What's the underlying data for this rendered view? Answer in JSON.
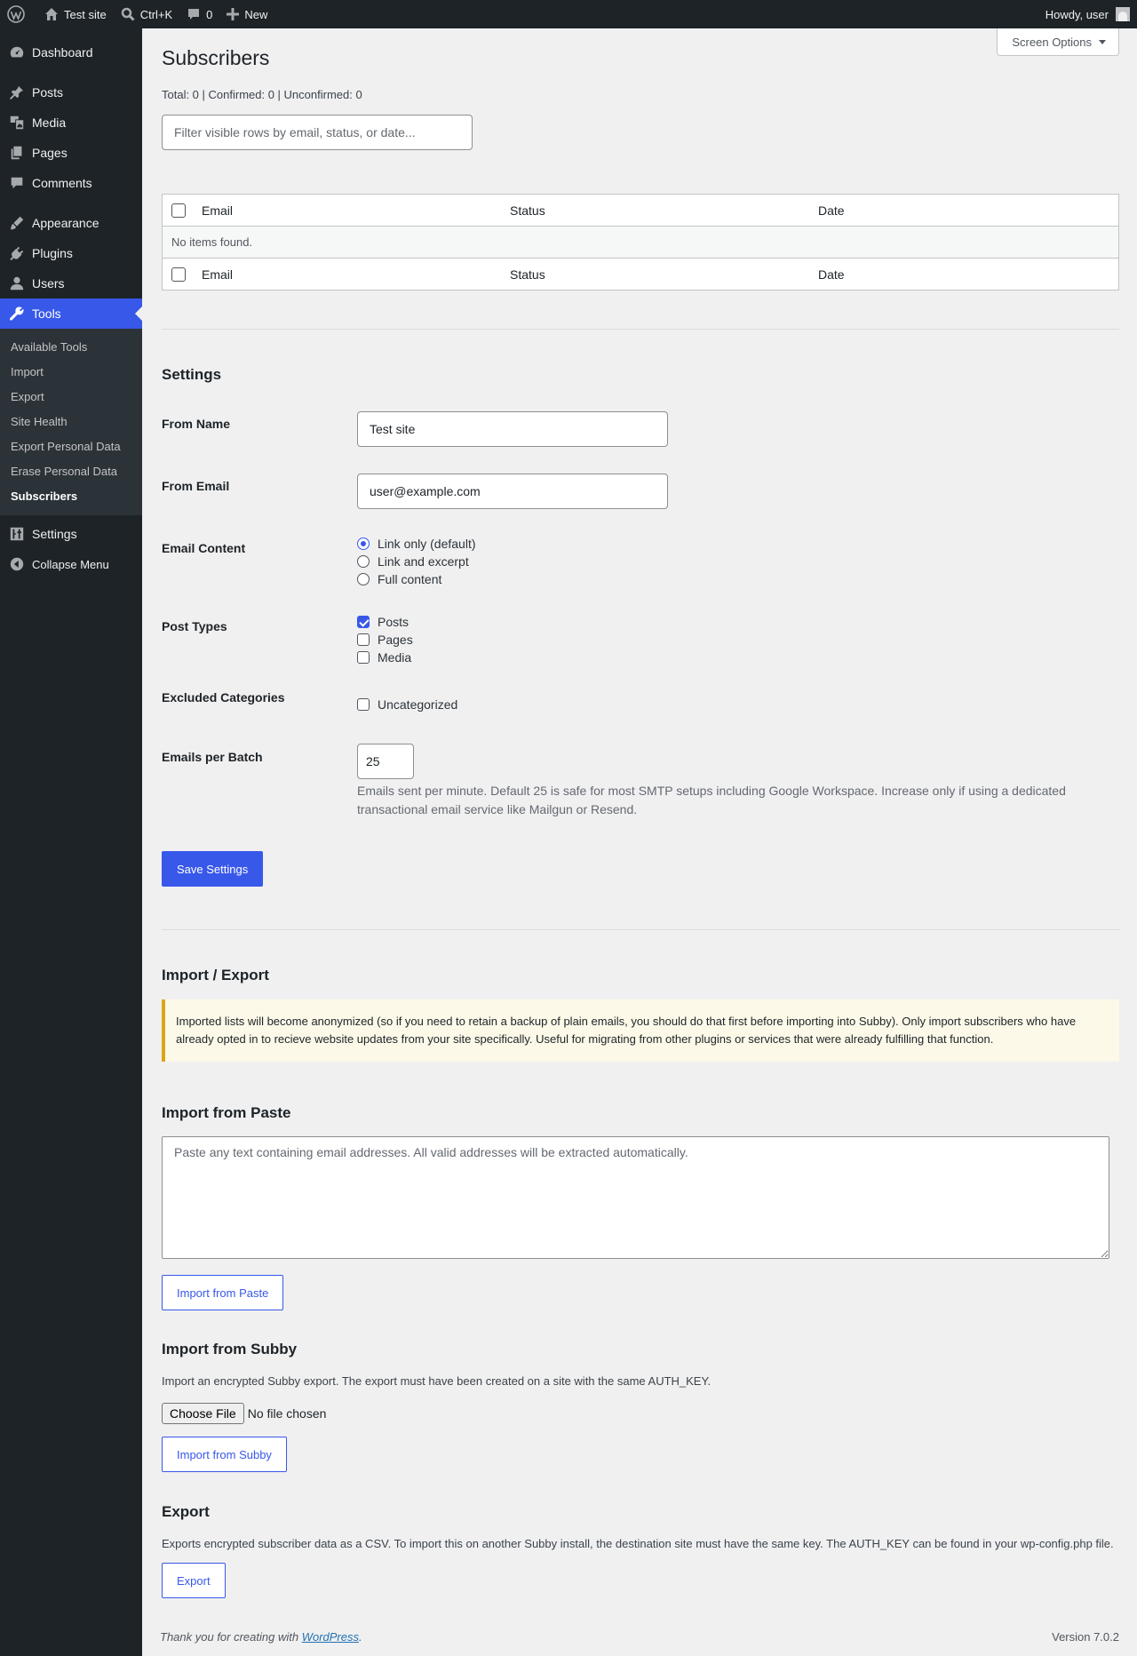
{
  "adminbar": {
    "site_name": "Test site",
    "search_shortcut": "Ctrl+K",
    "comments_count": "0",
    "new_label": "New",
    "howdy": "Howdy, user"
  },
  "sidebar": {
    "items": [
      {
        "label": "Dashboard",
        "icon": "dashboard-icon"
      },
      {
        "label": "Posts",
        "icon": "pin-icon"
      },
      {
        "label": "Media",
        "icon": "media-icon"
      },
      {
        "label": "Pages",
        "icon": "pages-icon"
      },
      {
        "label": "Comments",
        "icon": "comment-icon"
      },
      {
        "label": "Appearance",
        "icon": "brush-icon"
      },
      {
        "label": "Plugins",
        "icon": "plug-icon"
      },
      {
        "label": "Users",
        "icon": "user-icon"
      },
      {
        "label": "Tools",
        "icon": "wrench-icon"
      },
      {
        "label": "Settings",
        "icon": "sliders-icon"
      },
      {
        "label": "Collapse Menu",
        "icon": "collapse-icon"
      }
    ],
    "tools_submenu": [
      "Available Tools",
      "Import",
      "Export",
      "Site Health",
      "Export Personal Data",
      "Erase Personal Data",
      "Subscribers"
    ]
  },
  "page": {
    "title": "Subscribers",
    "screen_options": "Screen Options",
    "counts": "Total: 0 | Confirmed: 0 | Unconfirmed: 0",
    "filter_placeholder": "Filter visible rows by email, status, or date..."
  },
  "table": {
    "columns": [
      "Email",
      "Status",
      "Date"
    ],
    "empty_message": "No items found."
  },
  "settings": {
    "heading": "Settings",
    "from_name_label": "From Name",
    "from_name_value": "Test site",
    "from_email_label": "From Email",
    "from_email_value": "user@example.com",
    "email_content_label": "Email Content",
    "email_content_options": [
      "Link only (default)",
      "Link and excerpt",
      "Full content"
    ],
    "email_content_selected": "Link only (default)",
    "post_types_label": "Post Types",
    "post_types_options": [
      "Posts",
      "Pages",
      "Media"
    ],
    "post_types_checked": [
      "Posts"
    ],
    "excluded_categories_label": "Excluded Categories",
    "excluded_categories_options": [
      "Uncategorized"
    ],
    "emails_per_batch_label": "Emails per Batch",
    "emails_per_batch_value": "25",
    "emails_per_batch_desc": "Emails sent per minute. Default 25 is safe for most SMTP setups including Google Workspace. Increase only if using a dedicated transactional email service like Mailgun or Resend.",
    "save_label": "Save Settings"
  },
  "import_export": {
    "heading": "Import / Export",
    "notice": "Imported lists will become anonymized (so if you need to retain a backup of plain emails, you should do that first before importing into Subby). Only import subscribers who have already opted in to recieve website updates from your site specifically. Useful for migrating from other plugins or services that were already fulfilling that function.",
    "paste_heading": "Import from Paste",
    "paste_placeholder": "Paste any text containing email addresses. All valid addresses will be extracted automatically.",
    "paste_button": "Import from Paste",
    "subby_heading": "Import from Subby",
    "subby_desc": "Import an encrypted Subby export. The export must have been created on a site with the same AUTH_KEY.",
    "choose_file": "Choose File",
    "no_file": "No file chosen",
    "subby_button": "Import from Subby",
    "export_heading": "Export",
    "export_desc": "Exports encrypted subscriber data as a CSV. To import this on another Subby install, the destination site must have the same key. The AUTH_KEY can be found in your wp-config.php file.",
    "export_button": "Export"
  },
  "footer": {
    "thanks_prefix": "Thank you for creating with",
    "thanks_link": "WordPress",
    "thanks_suffix": ".",
    "version": "Version 7.0.2"
  },
  "colors": {
    "accent": "#3858e9",
    "adminbar_bg": "#1d2327",
    "notice_border": "#dba617"
  }
}
